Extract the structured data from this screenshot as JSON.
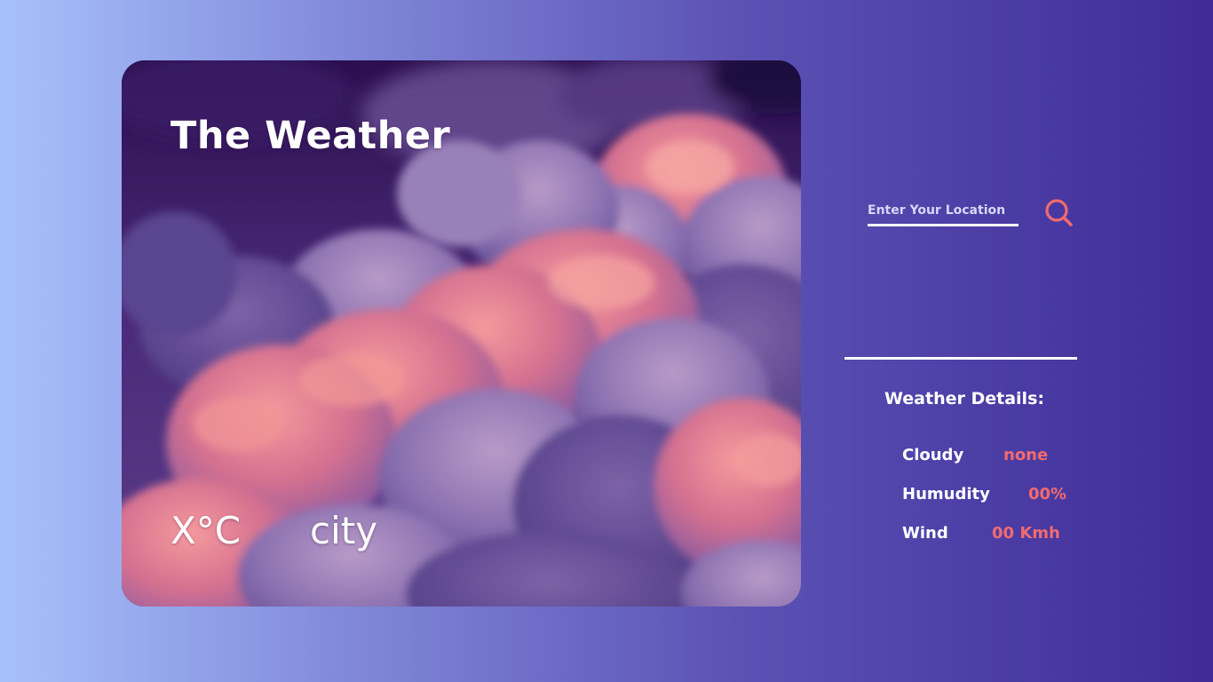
{
  "card": {
    "title": "The Weather",
    "temperature": "X°C",
    "city": "city"
  },
  "search": {
    "placeholder": "Enter Your Location",
    "value": ""
  },
  "details": {
    "heading": "Weather Details:",
    "rows": [
      {
        "label": "Cloudy",
        "value": "none"
      },
      {
        "label": "Humudity",
        "value": "00%"
      },
      {
        "label": "Wind",
        "value": "00 Kmh"
      }
    ]
  },
  "icons": {
    "search": "search-icon"
  },
  "colors": {
    "accent": "#f26b6f",
    "text": "#ffffff",
    "background_start": "#a7c1fb",
    "background_end": "#3f2b98"
  }
}
